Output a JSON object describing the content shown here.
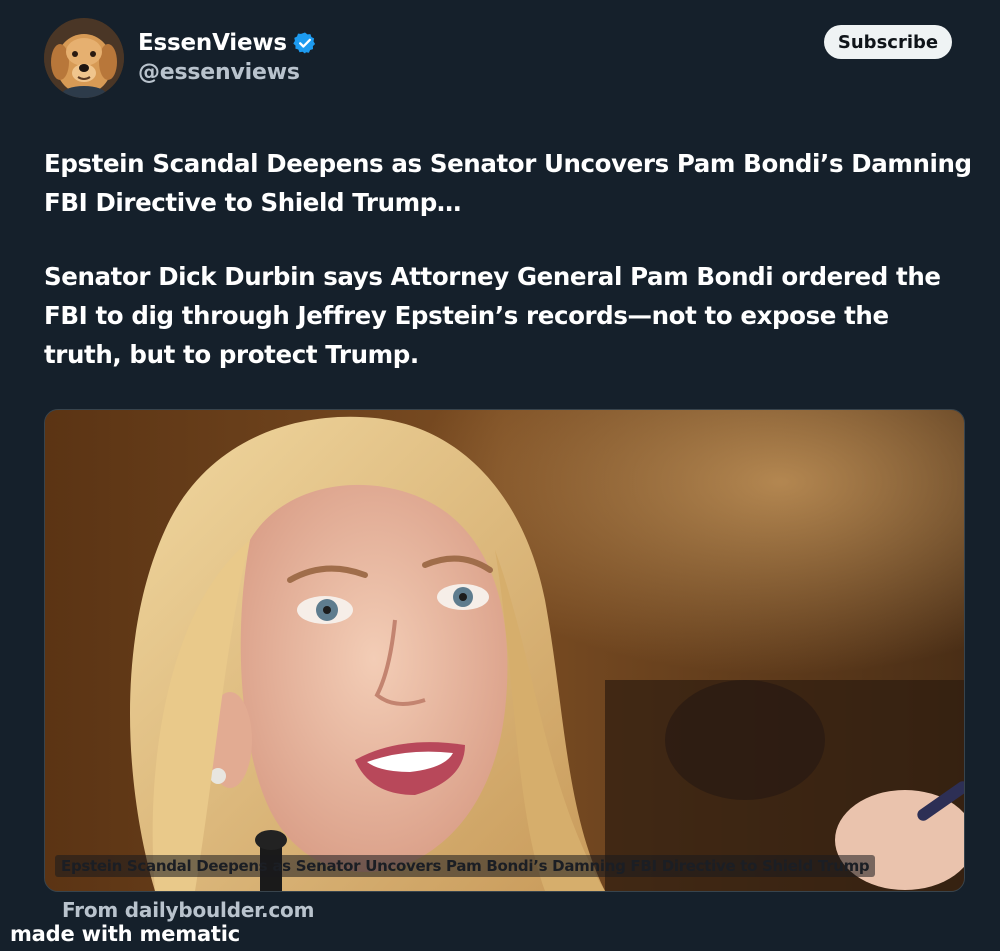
{
  "author": {
    "display_name": "EssenViews",
    "handle": "@essenviews",
    "verified_icon": "verified-badge-icon",
    "avatar": "golden-retriever-avatar"
  },
  "subscribe_label": "Subscribe",
  "post": {
    "paragraph1": "Epstein Scandal Deepens as Senator Uncovers Pam Bondi’s Damning FBI Directive to Shield Trump…",
    "paragraph2": "Senator Dick Durbin says Attorney General Pam Bondi ordered the FBI to dig through Jeffrey Epstein’s records—not to expose the truth, but to protect Trump."
  },
  "media": {
    "image": "woman-speaking-at-hearing-photo",
    "caption": "Epstein Scandal Deepens as Senator Uncovers Pam Bondi’s Damning FBI Directive to Shield Trump"
  },
  "source": "From dailyboulder.com",
  "watermark": "made with mematic",
  "colors": {
    "background": "#15202b",
    "text_primary": "#ffffff",
    "text_secondary": "#b9c3cd",
    "verified": "#1d9bf0",
    "button_bg": "#eff3f4"
  }
}
